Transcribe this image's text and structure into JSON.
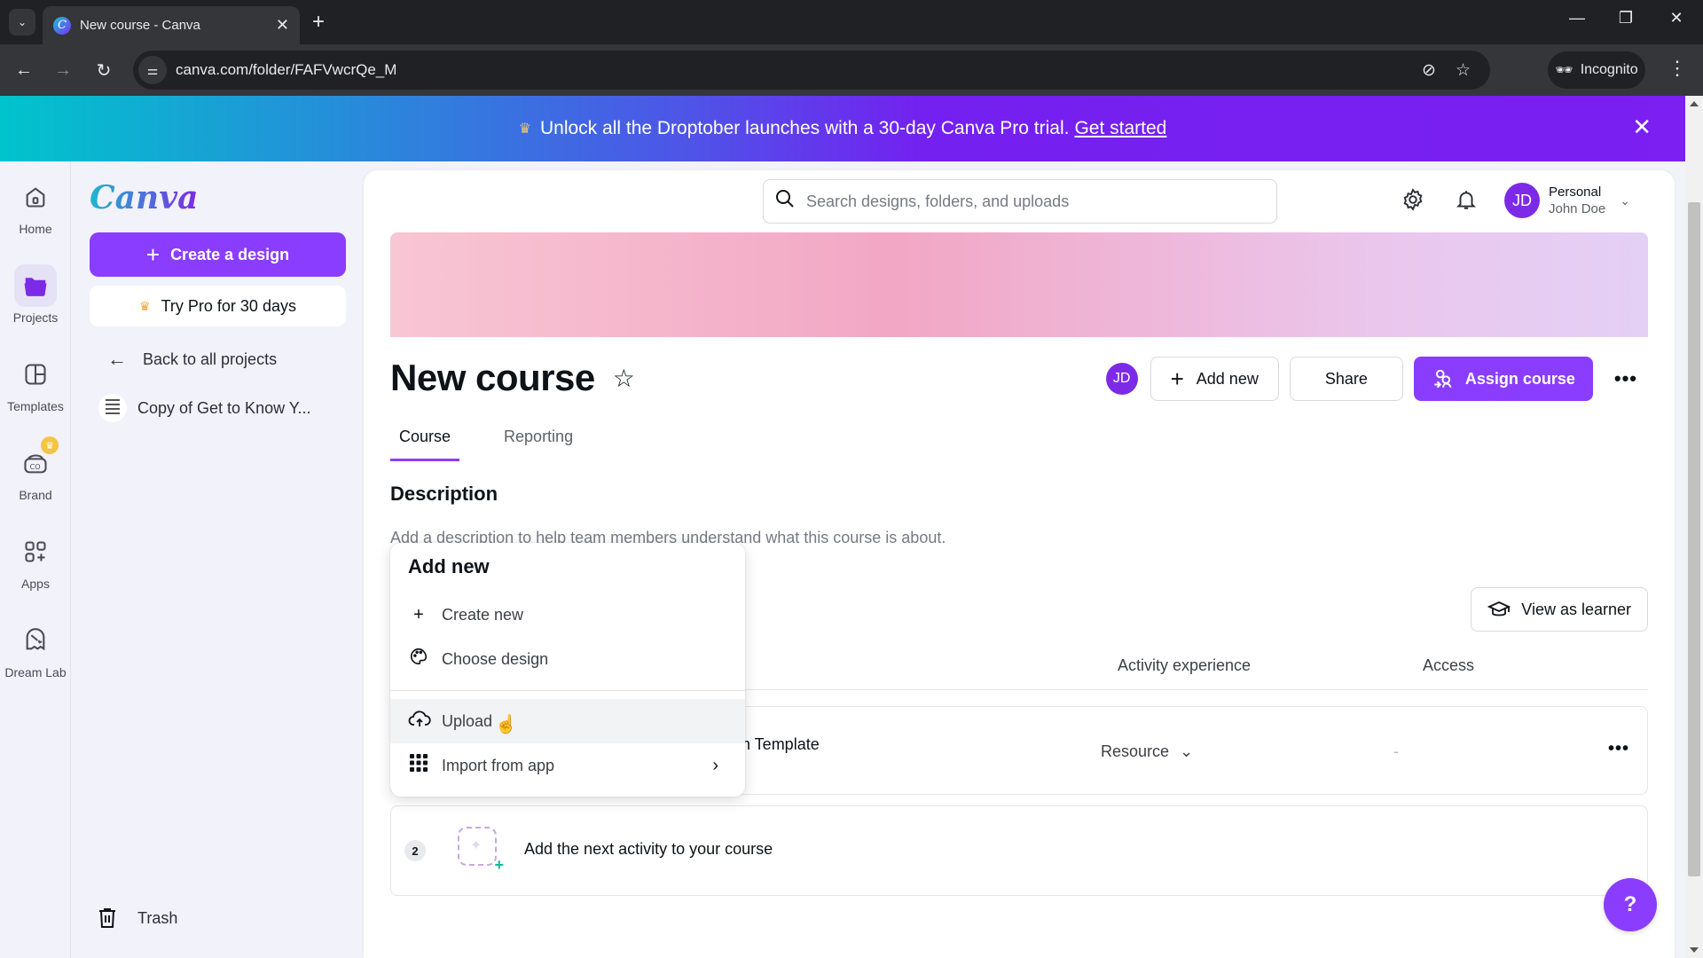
{
  "browser": {
    "tab_title": "New course - Canva",
    "url": "canva.com/folder/FAFVwcrQe_M",
    "incognito_label": "Incognito"
  },
  "banner": {
    "text": "Unlock all the Droptober launches with a 30-day Canva Pro trial.",
    "link": "Get started"
  },
  "rail": {
    "items": [
      {
        "label": "Home",
        "icon": "home-icon"
      },
      {
        "label": "Projects",
        "icon": "folder-icon",
        "active": true
      },
      {
        "label": "Templates",
        "icon": "templates-icon"
      },
      {
        "label": "Brand",
        "icon": "brand-icon",
        "badge": "crown"
      },
      {
        "label": "Apps",
        "icon": "apps-icon"
      },
      {
        "label": "Dream Lab",
        "icon": "dream-lab-icon"
      }
    ]
  },
  "sidebar": {
    "logo": "Canva",
    "create_button": "Create a design",
    "try_pro_button": "Try Pro for 30 days",
    "back_link": "Back to all projects",
    "project_item": "Copy of Get to Know Y...",
    "trash": "Trash"
  },
  "header": {
    "search_placeholder": "Search designs, folders, and uploads",
    "account_type": "Personal",
    "user_name": "John Doe",
    "avatar_initials": "JD"
  },
  "course": {
    "title": "New course",
    "actions": {
      "avatar_initials": "JD",
      "add_new": "Add new",
      "share": "Share",
      "assign": "Assign course",
      "more": "•••"
    },
    "tabs": [
      {
        "label": "Course",
        "active": true
      },
      {
        "label": "Reporting",
        "active": false
      }
    ],
    "description_heading": "Description",
    "description_placeholder": "Add a description to help team members understand what this course is about.",
    "view_as_learner": "View as learner",
    "table": {
      "columns": [
        "Activity experience",
        "Access"
      ],
      "rows": [
        {
          "name_visible": "am Template",
          "activity_experience": "Resource",
          "access": "-"
        }
      ],
      "next_row": {
        "number": "2",
        "text": "Add the next activity to your course"
      }
    }
  },
  "add_new_menu": {
    "title": "Add new",
    "items": [
      {
        "label": "Create new",
        "icon": "plus-icon"
      },
      {
        "label": "Choose design",
        "icon": "palette-icon"
      },
      {
        "label": "Upload",
        "icon": "cloud-upload-icon",
        "hovered": true
      },
      {
        "label": "Import from app",
        "icon": "grid-icon",
        "submenu": true
      }
    ]
  },
  "help_button": "?",
  "colors": {
    "brand_purple": "#8b3dff",
    "avatar_purple": "#7d2ae8",
    "banner_start": "#00c4cc",
    "banner_end": "#7b1ff2"
  }
}
